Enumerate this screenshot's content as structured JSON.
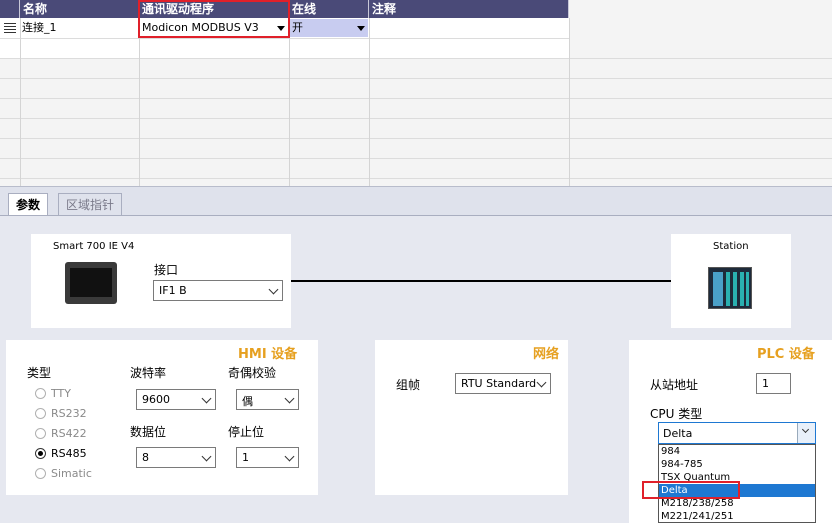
{
  "table": {
    "headers": [
      "名称",
      "通讯驱动程序",
      "在线",
      "注释"
    ],
    "row": {
      "name": "连接_1",
      "driver": "Modicon MODBUS V3",
      "online": "开",
      "comment": ""
    }
  },
  "tabs": [
    "参数",
    "区域指针"
  ],
  "hmi_device": {
    "name": "Smart 700 IE V4",
    "interface_label": "接口",
    "interface_value": "IF1 B"
  },
  "station": {
    "name": "Station"
  },
  "hmi_settings": {
    "title": "HMI 设备",
    "type_label": "类型",
    "types": [
      "TTY",
      "RS232",
      "RS422",
      "RS485",
      "Simatic"
    ],
    "selected_type": "RS485",
    "baud_label": "波特率",
    "baud_value": "9600",
    "parity_label": "奇偶校验",
    "parity_value": "偶",
    "databits_label": "数据位",
    "databits_value": "8",
    "stopbits_label": "停止位",
    "stopbits_value": "1"
  },
  "network": {
    "title": "网络",
    "profile_label": "组帧",
    "profile_value": "RTU Standard"
  },
  "plc": {
    "title": "PLC 设备",
    "slave_label": "从站地址",
    "slave_value": "1",
    "cpu_label": "CPU 类型",
    "cpu_value": "Delta",
    "cpu_options": [
      "984",
      "984-785",
      "TSX Quantum",
      "Delta",
      "M218/238/258",
      "M221/241/251"
    ],
    "cpu_selected": "Delta"
  },
  "colors": {
    "header": "#4a4a78",
    "accent": "#e6a020",
    "selection": "#1e78d2",
    "highlight": "#e0202a"
  }
}
